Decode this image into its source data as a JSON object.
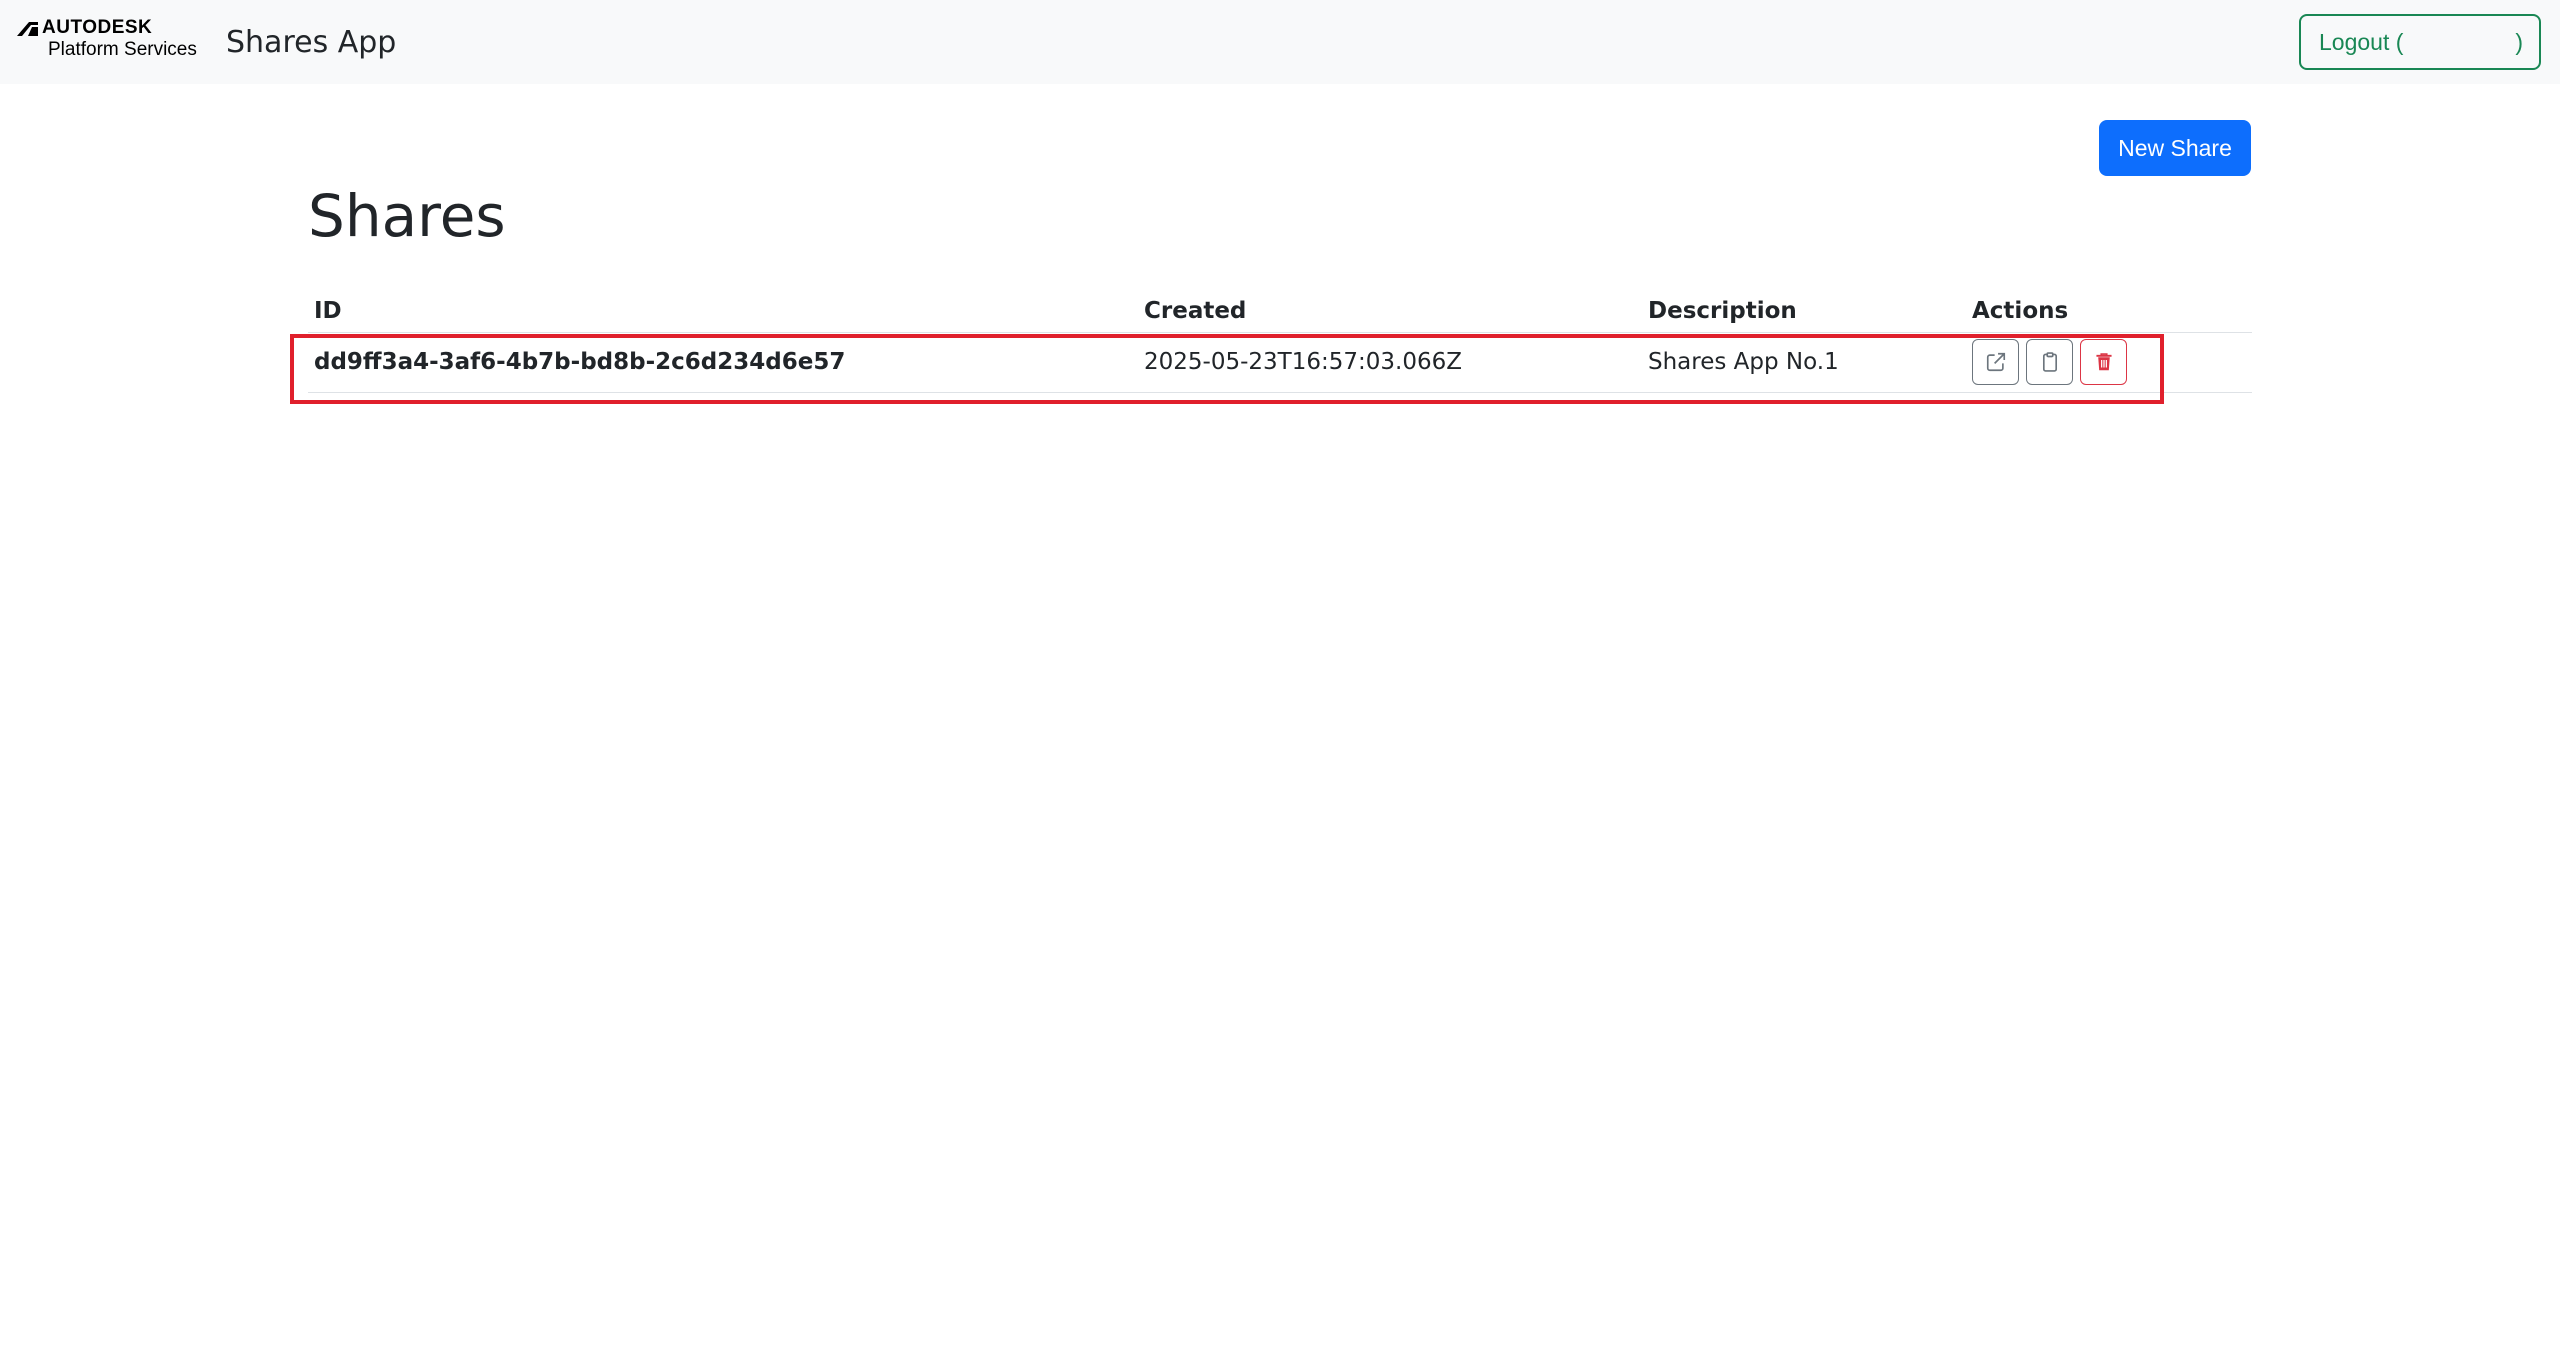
{
  "navbar": {
    "brand_line1": "AUTODESK",
    "brand_line2": "Platform Services",
    "app_title": "Shares App",
    "logout_label": "Logout (",
    "logout_suffix": ")"
  },
  "main": {
    "page_title": "Shares",
    "new_share_label": "New Share",
    "table": {
      "headers": [
        "ID",
        "Created",
        "Description",
        "Actions"
      ],
      "rows": [
        {
          "id": "dd9ff3a4-3af6-4b7b-bd8b-2c6d234d6e57",
          "created": "2025-05-23T16:57:03.066Z",
          "description": "Shares App No.1",
          "actions": [
            "external-link-icon",
            "clipboard-icon",
            "trash-icon"
          ]
        }
      ]
    }
  },
  "colors": {
    "primary": "#0d6efd",
    "success": "#198754",
    "danger": "#dc3545",
    "secondary": "#6c757d",
    "highlight": "#e0202c"
  }
}
